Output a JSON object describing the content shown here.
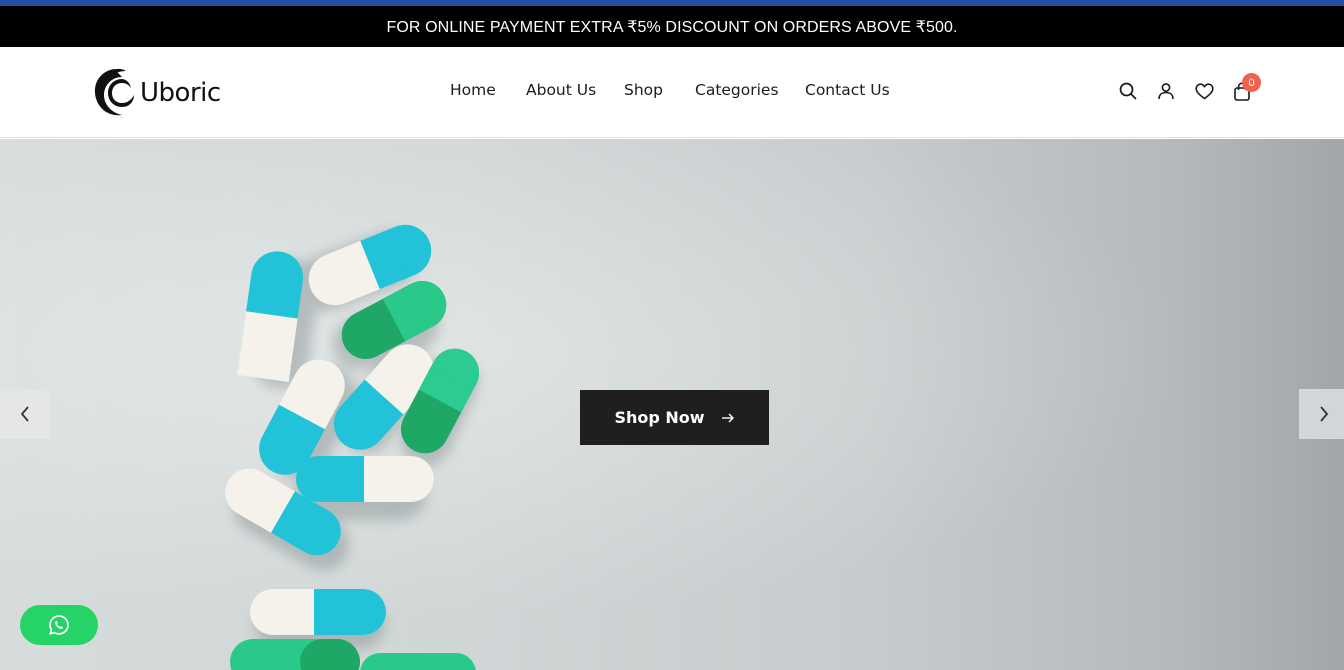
{
  "announcement": {
    "text": "FOR ONLINE PAYMENT EXTRA ₹5% DISCOUNT ON ORDERS ABOVE ₹500."
  },
  "header": {
    "logo_text": "Uboric",
    "nav": [
      {
        "label": "Home"
      },
      {
        "label": "About Us"
      },
      {
        "label": "Shop"
      },
      {
        "label": "Categories"
      },
      {
        "label": "Contact Us"
      }
    ],
    "icons": [
      "search-icon",
      "user-icon",
      "heart-icon",
      "bag-icon"
    ],
    "cart_count": "0"
  },
  "hero": {
    "cta_label": "Shop Now",
    "prev_icon": "chevron-left-icon",
    "next_icon": "chevron-right-icon"
  },
  "floating": {
    "whatsapp_icon": "whatsapp-icon"
  },
  "colors": {
    "announcement_bg": "#000000",
    "top_accent": "#2450a3",
    "cta_bg": "#1f1f1f",
    "badge": "#f0624d",
    "whatsapp": "#25d366",
    "pill_cyan": "#22c3d9",
    "pill_green": "#22b873"
  }
}
